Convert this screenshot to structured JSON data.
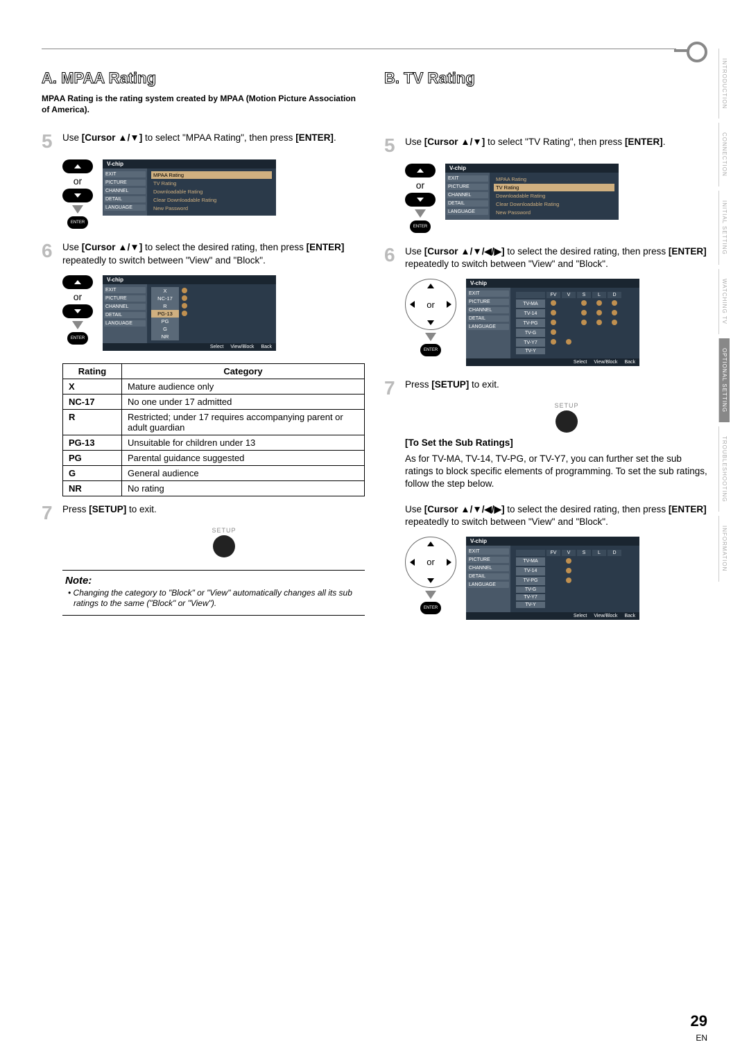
{
  "page_number": "29",
  "page_lang": "EN",
  "side_tabs": [
    "INTRODUCTION",
    "CONNECTION",
    "INITIAL SETTING",
    "WATCHING TV",
    "OPTIONAL SETTING",
    "TROUBLESHOOTING",
    "INFORMATION"
  ],
  "side_active_index": 4,
  "colA": {
    "title_lead": "A.",
    "title": "MPAA Rating",
    "intro": "MPAA Rating is the rating system created by MPAA (Motion Picture Association of America).",
    "step5_num": "5",
    "step5_a": "Use ",
    "step5_b": "[Cursor ▲/▼]",
    "step5_c": " to select \"MPAA Rating\", then press ",
    "step5_d": "[ENTER]",
    "step5_e": ".",
    "or": "or",
    "enter": "ENTER",
    "osd_title": "V-chip",
    "osd_side": [
      "EXIT",
      "PICTURE",
      "CHANNEL",
      "DETAIL",
      "LANGUAGE"
    ],
    "osd_items": [
      "MPAA Rating",
      "TV Rating",
      "Downloadable Rating",
      "Clear Downloadable Rating",
      "New Password"
    ],
    "step6_num": "6",
    "step6_a": "Use ",
    "step6_b": "[Cursor ▲/▼]",
    "step6_c": " to select the desired rating, then press ",
    "step6_d": "[ENTER]",
    "step6_e": " repeatedly to switch between \"View\" and \"Block\".",
    "osd2_ratings": [
      "X",
      "NC-17",
      "R",
      "PG-13",
      "PG",
      "G",
      "NR"
    ],
    "osd_foot_select": "Select",
    "osd_foot_vb": "View/Block",
    "osd_foot_back": "Back",
    "table_h1": "Rating",
    "table_h2": "Category",
    "table": [
      {
        "r": "X",
        "c": "Mature audience only"
      },
      {
        "r": "NC-17",
        "c": "No one under 17 admitted"
      },
      {
        "r": "R",
        "c": "Restricted; under 17 requires accompanying parent or adult guardian"
      },
      {
        "r": "PG-13",
        "c": "Unsuitable for children under 13"
      },
      {
        "r": "PG",
        "c": "Parental guidance suggested"
      },
      {
        "r": "G",
        "c": "General audience"
      },
      {
        "r": "NR",
        "c": "No rating"
      }
    ],
    "step7_num": "7",
    "step7_a": "Press ",
    "step7_b": "[SETUP]",
    "step7_c": " to exit.",
    "setup_label": "SETUP",
    "note_title": "Note:",
    "note_text": "• Changing the category to \"Block\" or \"View\" automatically changes all its sub ratings to the same (\"Block\" or \"View\")."
  },
  "colB": {
    "title_lead": "B.",
    "title": "TV Rating",
    "step5_num": "5",
    "step5_a": "Use ",
    "step5_b": "[Cursor ▲/▼]",
    "step5_c": " to select \"TV Rating\", then press ",
    "step5_d": "[ENTER]",
    "step5_e": ".",
    "step6_num": "6",
    "step6_a": "Use ",
    "step6_b": "[Cursor ▲/▼/◀/▶]",
    "step6_c": " to select the desired rating, then press ",
    "step6_d": "[ENTER]",
    "step6_e": " repeatedly to switch between \"View\" and \"Block\".",
    "tv_cols": [
      "FV",
      "V",
      "S",
      "L",
      "D"
    ],
    "tv_rows": [
      "TV-MA",
      "TV-14",
      "TV-PG",
      "TV-G",
      "TV-Y7",
      "TV-Y"
    ],
    "step7_num": "7",
    "step7_a": "Press ",
    "step7_b": "[SETUP]",
    "step7_c": " to exit.",
    "sub_head": "[To Set the Sub Ratings]",
    "sub_p1": "As for TV-MA, TV-14, TV-PG, or TV-Y7, you can further set the sub ratings to block specific elements of programming. To set the sub ratings, follow the step below.",
    "sub_p2a": "Use ",
    "sub_p2b": "[Cursor ▲/▼/◀/▶]",
    "sub_p2c": " to select the desired rating, then press ",
    "sub_p2d": "[ENTER]",
    "sub_p2e": " repeatedly to switch between \"View\" and \"Block\"."
  }
}
